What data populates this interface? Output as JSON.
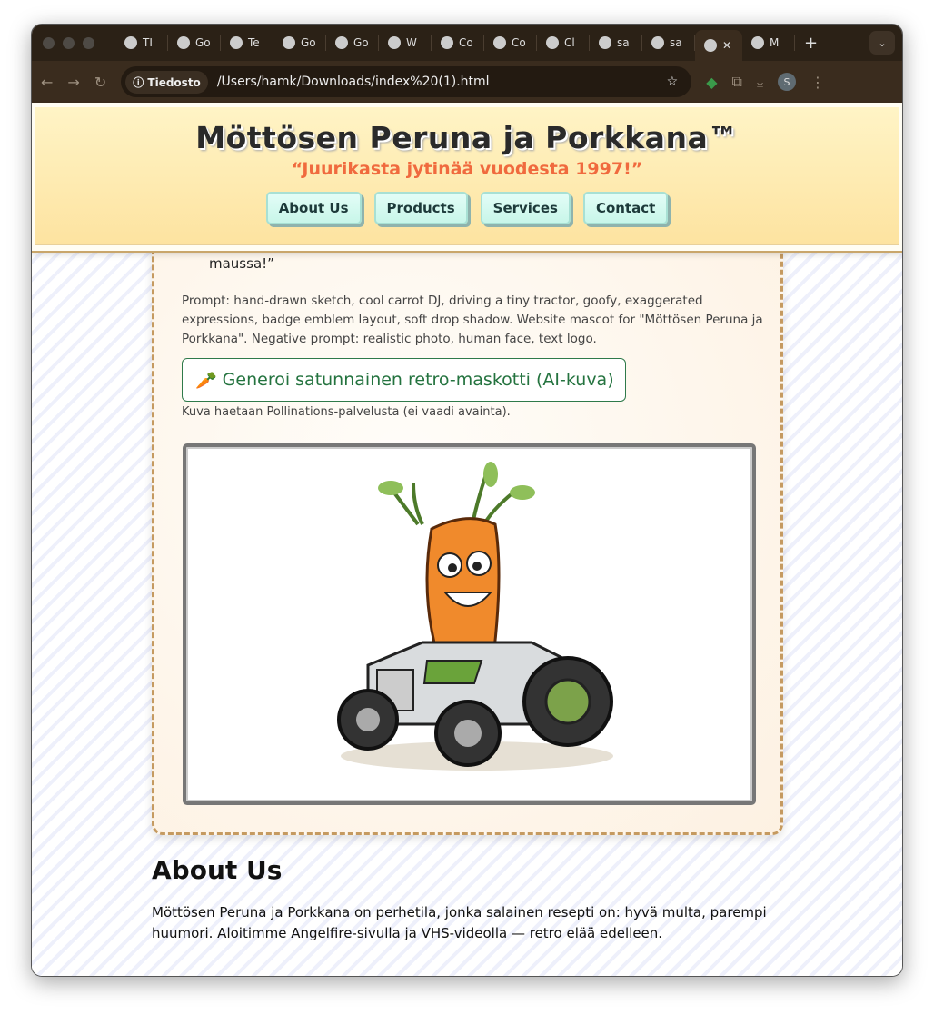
{
  "browser": {
    "tabs": [
      {
        "label": "TI",
        "icon": "tinkercad-icon"
      },
      {
        "label": "Go",
        "icon": "app-icon"
      },
      {
        "label": "Te",
        "icon": "app-icon"
      },
      {
        "label": "Go",
        "icon": "gemini-icon"
      },
      {
        "label": "Go",
        "icon": "app-icon"
      },
      {
        "label": "W",
        "icon": "openai-icon"
      },
      {
        "label": "Co",
        "icon": "app-icon"
      },
      {
        "label": "Co",
        "icon": "app-icon"
      },
      {
        "label": "Cl",
        "icon": "openai-icon"
      },
      {
        "label": "sa",
        "icon": "github-icon"
      },
      {
        "label": "sa",
        "icon": "github-icon"
      },
      {
        "label": "✕",
        "icon": "globe-icon",
        "active": true
      },
      {
        "label": "M",
        "icon": "globe-icon"
      }
    ],
    "new_tab": "+",
    "site_chip": "Tiedosto",
    "url": "/Users/hamk/Downloads/index%20(1).html",
    "profile": "S"
  },
  "header": {
    "title": "Möttösen Peruna ja Porkkana™",
    "tagline": "“Juurikasta jytinää vuodesta 1997!”",
    "nav": [
      "About Us",
      "Products",
      "Services",
      "Contact"
    ]
  },
  "mascot": {
    "quote_tail": "maussa!”",
    "prompt": "Prompt: hand-drawn sketch, cool carrot DJ, driving a tiny tractor, goofy, exaggerated expressions, badge emblem layout, soft drop shadow. Website mascot for \"Möttösen Peruna ja Porkkana\". Negative prompt: realistic photo, human face, text logo.",
    "button_icon": "🥕",
    "button": "Generoi satunnainen retro-maskotti (AI-kuva)",
    "note": "Kuva haetaan Pollinations-palvelusta (ei vaadi avainta)."
  },
  "about": {
    "heading": "About Us",
    "text": "Möttösen Peruna ja Porkkana on perhetila, jonka salainen resepti on: hyvä multa, parempi huumori. Aloitimme Angelfire-sivulla ja VHS-videolla — retro elää edelleen."
  }
}
